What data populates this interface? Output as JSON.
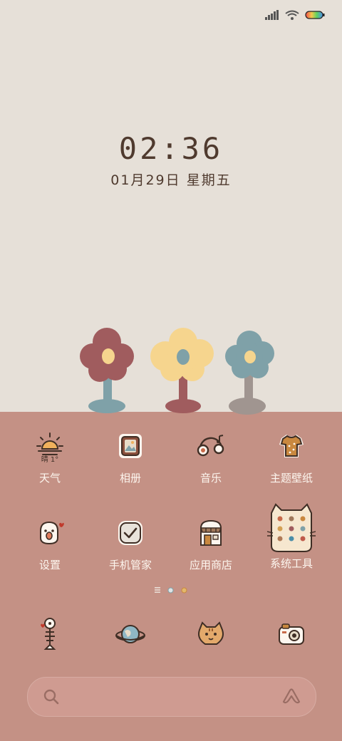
{
  "clock": {
    "time": "02:36",
    "date": "01月29日 星期五"
  },
  "status_bar": {
    "signal": "signal-icon",
    "wifi": "wifi-icon",
    "battery": "battery-icon"
  },
  "home": {
    "row1": [
      {
        "label": "天气",
        "icon": "weather-sun-icon",
        "temp": "晴 1°"
      },
      {
        "label": "相册",
        "icon": "photo-frame-icon"
      },
      {
        "label": "音乐",
        "icon": "headphones-icon"
      },
      {
        "label": "主题壁纸",
        "icon": "shirt-icon"
      }
    ],
    "row2": [
      {
        "label": "设置",
        "icon": "settings-chick-icon"
      },
      {
        "label": "手机管家",
        "icon": "shield-check-icon"
      },
      {
        "label": "应用商店",
        "icon": "store-icon"
      },
      {
        "label": "系统工具",
        "icon": "folder-icon"
      }
    ]
  },
  "dock": [
    {
      "icon": "fish-bone-icon"
    },
    {
      "icon": "planet-browser-icon"
    },
    {
      "icon": "cat-icon"
    },
    {
      "icon": "camera-icon"
    }
  ],
  "search": {
    "icon": "search-icon",
    "assistant_icon": "assistant-icon"
  },
  "colors": {
    "sky": "#e6e0d8",
    "ground": "#c49185",
    "text_dark": "#4f3a2e",
    "label": "#fdf6ef"
  }
}
